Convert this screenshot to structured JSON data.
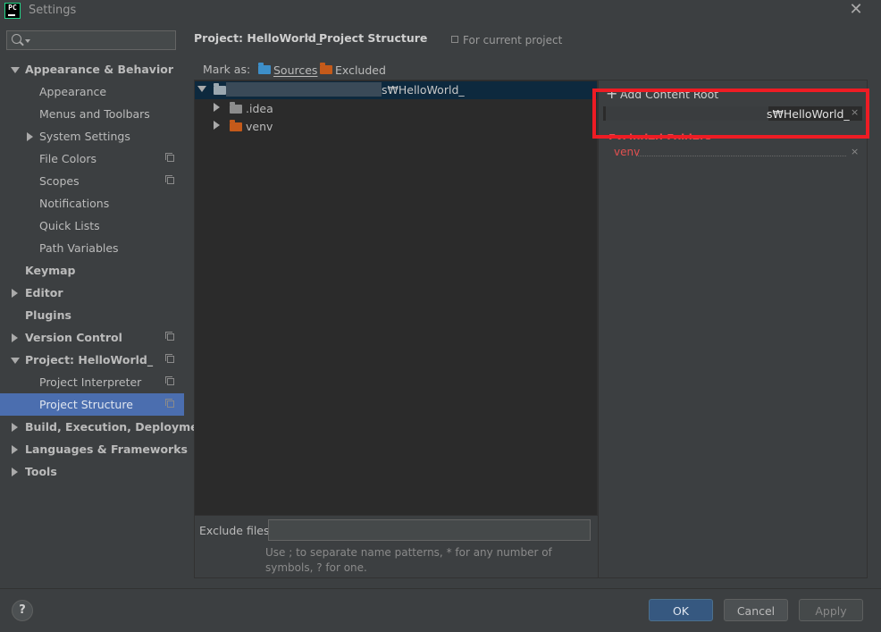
{
  "window": {
    "title": "Settings",
    "logo_text": "PC"
  },
  "sidebar": {
    "search": {
      "value": "",
      "placeholder": ""
    },
    "items": [
      {
        "label": "Appearance & Behavior",
        "level": 0,
        "expanded": true
      },
      {
        "label": "Appearance",
        "level": 1
      },
      {
        "label": "Menus and Toolbars",
        "level": 1
      },
      {
        "label": "System Settings",
        "level": 1,
        "expandable": true
      },
      {
        "label": "File Colors",
        "level": 1,
        "project_icon": true
      },
      {
        "label": "Scopes",
        "level": 1,
        "project_icon": true
      },
      {
        "label": "Notifications",
        "level": 1
      },
      {
        "label": "Quick Lists",
        "level": 1
      },
      {
        "label": "Path Variables",
        "level": 1
      },
      {
        "label": "Keymap",
        "level": 0
      },
      {
        "label": "Editor",
        "level": 0,
        "expandable": true
      },
      {
        "label": "Plugins",
        "level": 0
      },
      {
        "label": "Version Control",
        "level": 0,
        "expandable": true,
        "project_icon": true
      },
      {
        "label": "Project: HelloWorld_",
        "level": 0,
        "expanded": true,
        "project_icon": true
      },
      {
        "label": "Project Interpreter",
        "level": 1,
        "project_icon": true
      },
      {
        "label": "Project Structure",
        "level": 1,
        "project_icon": true,
        "selected": true
      },
      {
        "label": "Build, Execution, Deployment",
        "level": 0,
        "expandable": true
      },
      {
        "label": "Languages & Frameworks",
        "level": 0,
        "expandable": true
      },
      {
        "label": "Tools",
        "level": 0,
        "expandable": true
      }
    ]
  },
  "header": {
    "breadcrumb_project": "Project: HelloWorld_",
    "breadcrumb_separator": "›",
    "breadcrumb_page": "Project Structure",
    "scope_note": "For current project"
  },
  "mark_as": {
    "label": "Mark as:",
    "sources": "Sources",
    "excluded": "Excluded"
  },
  "tree": {
    "root_label": "s₩HelloWorld_",
    "children": [
      {
        "label": ".idea"
      },
      {
        "label": "venv"
      }
    ]
  },
  "exclude_files": {
    "label": "Exclude files:",
    "value": "",
    "hint": "Use ; to separate name patterns, * for any number of symbols, ? for one."
  },
  "content_root": {
    "add_label": "Add Content Root",
    "path": "s₩HelloWorld_",
    "remove_glyph": "×",
    "excluded_heading": "Excluded Folders",
    "excluded_items": [
      "venv"
    ]
  },
  "footer": {
    "help": "?",
    "ok": "OK",
    "cancel": "Cancel",
    "apply": "Apply"
  },
  "colors": {
    "selection": "#4b6eaf",
    "sources_folder": "#3d8fc9",
    "excluded_folder": "#c55a1a",
    "excluded_text": "#e05050",
    "highlight": "#ee1c24"
  }
}
